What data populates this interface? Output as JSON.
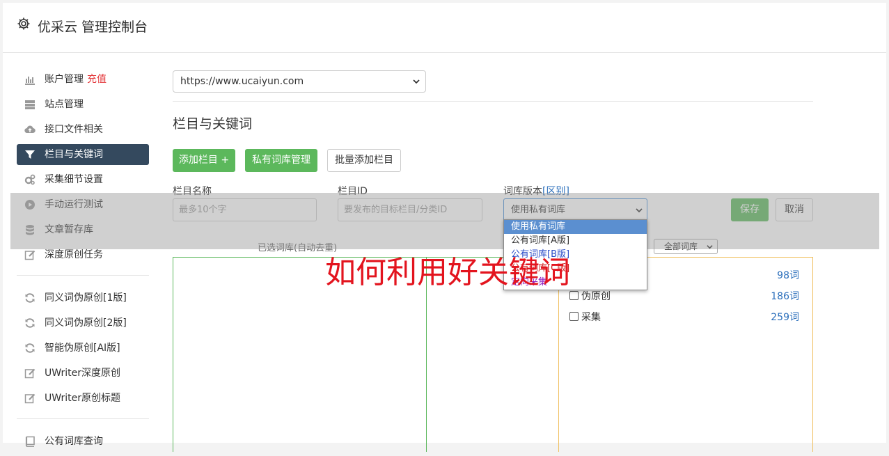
{
  "header": {
    "title": "优采云 管理控制台"
  },
  "sidebar": {
    "group1": [
      {
        "label": "账户管理",
        "badge": "充值",
        "icon": "bar-chart-icon"
      },
      {
        "label": "站点管理",
        "icon": "server-icon"
      },
      {
        "label": "接口文件相关",
        "icon": "cloud-upload-icon"
      },
      {
        "label": "栏目与关键词",
        "icon": "filter-icon",
        "active": true
      },
      {
        "label": "采集细节设置",
        "icon": "gears-icon"
      },
      {
        "label": "手动运行测试",
        "icon": "play-icon"
      },
      {
        "label": "文章暂存库",
        "icon": "database-icon"
      },
      {
        "label": "深度原创任务",
        "icon": "edit-icon"
      }
    ],
    "group2": [
      {
        "label": "同义词伪原创[1版]",
        "icon": "refresh-icon"
      },
      {
        "label": "同义词伪原创[2版]",
        "icon": "refresh-icon"
      },
      {
        "label": "智能伪原创[AI版]",
        "icon": "refresh-icon"
      },
      {
        "label": "UWriter深度原创",
        "icon": "edit-icon"
      },
      {
        "label": "UWriter原创标题",
        "icon": "edit-icon"
      }
    ],
    "group3": [
      {
        "label": "公有词库查询",
        "icon": "book-icon"
      }
    ]
  },
  "main": {
    "site_select": "https://www.ucaiyun.com",
    "section_title": "栏目与关键词",
    "buttons": {
      "add_column": "添加栏目 +",
      "private_lib": "私有词库管理",
      "batch_add": "批量添加栏目",
      "save": "保存",
      "cancel": "取消"
    },
    "form": {
      "column_name_label": "栏目名称",
      "column_name_placeholder": "最多10个字",
      "column_id_label": "栏目ID",
      "column_id_placeholder": "要发布的目标栏目/分类ID",
      "version_label": "词库版本",
      "version_link": "[区别]",
      "version_value": "使用私有词库"
    },
    "dropdown": [
      {
        "label": "使用私有词库",
        "style": "sel"
      },
      {
        "label": "公有词库[A版]",
        "style": ""
      },
      {
        "label": "公有词库[B版]",
        "style": "c-blue"
      },
      {
        "label": "公有词库[C版]",
        "style": "c-red"
      },
      {
        "label": "定向采集",
        "style": "c-purple"
      }
    ],
    "selected_panel_title": "已选词库(自动去重)",
    "lib_filter": "全部词库",
    "libraries": [
      {
        "name": "",
        "count": "98词"
      },
      {
        "name": "伪原创",
        "count": "186词"
      },
      {
        "name": "采集",
        "count": "259词"
      }
    ],
    "watermark": "如何利用好关键词"
  },
  "colors": {
    "green": "#5cb85c",
    "active_nav": "#34495e",
    "link": "#2a6ebb",
    "watermark": "#e3141e"
  }
}
